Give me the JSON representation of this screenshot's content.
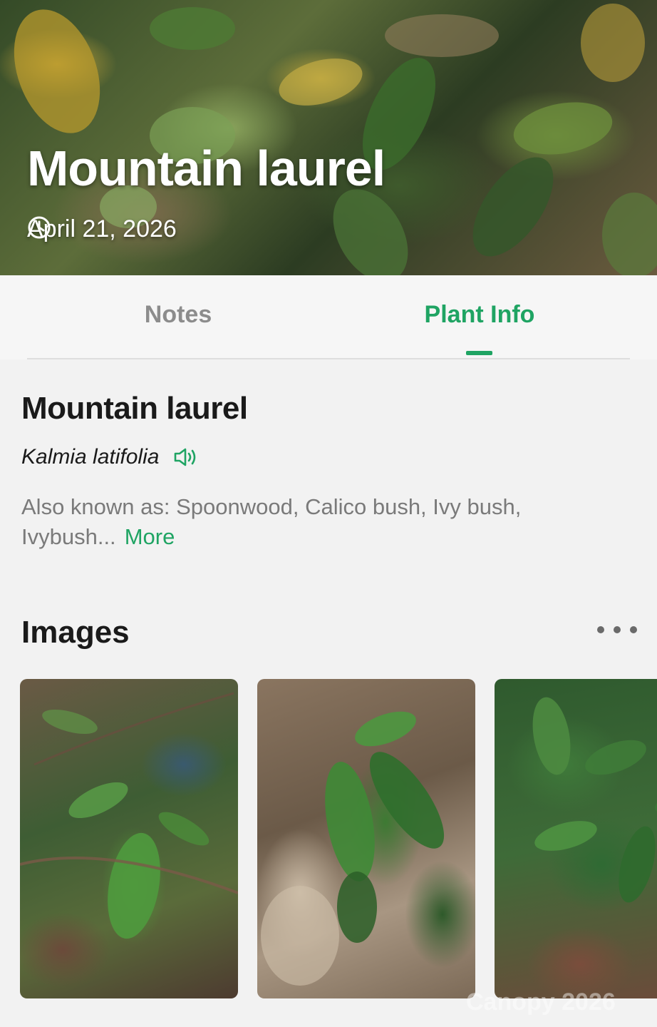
{
  "header": {
    "title": "Mountain laurel",
    "date": "April 21, 2026",
    "icons": {
      "date": "clock-icon"
    }
  },
  "tabs": [
    {
      "label": "Notes",
      "active": false
    },
    {
      "label": "Plant Info",
      "active": true
    }
  ],
  "plant_info": {
    "common_name": "Mountain laurel",
    "scientific_name": "Kalmia latifolia",
    "aka_text": "Also known as: Spoonwood, Calico bush, Ivy bush, Ivybush...",
    "more_label": "More",
    "icons": {
      "pronounce": "speaker-icon"
    }
  },
  "images_section": {
    "title": "Images",
    "icons": {
      "menu": "more-horizontal-icon"
    }
  },
  "watermark": "Canopy 2026",
  "colors": {
    "accent": "#1fa463",
    "inactive_tab": "#8c8c8c",
    "background": "#f2f2f2",
    "text": "#1a1a1a",
    "muted_text": "#7a7a7a"
  }
}
